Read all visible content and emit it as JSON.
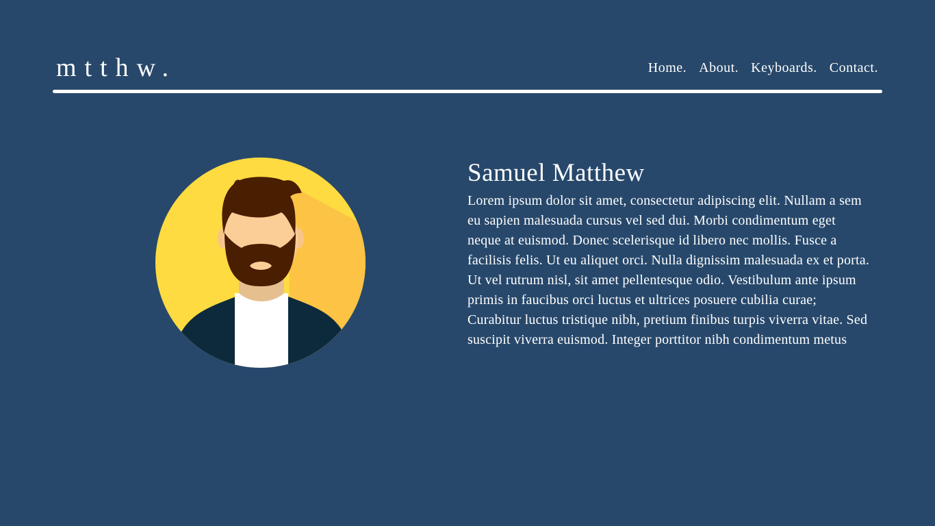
{
  "header": {
    "logo": "mtthw.",
    "nav": [
      "Home.",
      "About.",
      "Keyboards.",
      "Contact."
    ]
  },
  "profile": {
    "name": "Samuel Matthew",
    "bio": "Lorem ipsum dolor sit amet, consectetur adipiscing elit. Nullam a sem eu sapien malesuada cursus vel sed dui. Morbi condimentum eget neque at euismod. Donec scelerisque id libero nec mollis. Fusce a facilisis felis. Ut eu aliquet orci. Nulla dignissim malesuada ex et porta. Ut vel rutrum nisl, sit amet pellentesque odio. Vestibulum ante ipsum primis in faucibus orci luctus et ultrices posuere cubilia curae; Curabitur luctus tristique nibh, pretium finibus turpis viverra vitae. Sed suscipit viverra euismod. Integer porttitor nibh condimentum metus",
    "avatar_icon": "bearded-man-avatar-icon"
  },
  "colors": {
    "background": "#27486b",
    "text": "#ffffff",
    "avatar_circle": "#fedb41",
    "avatar_shadow": "#fcc344",
    "hair": "#4a1e00",
    "skin": "#fbcd97",
    "jacket": "#0d2a3c"
  }
}
